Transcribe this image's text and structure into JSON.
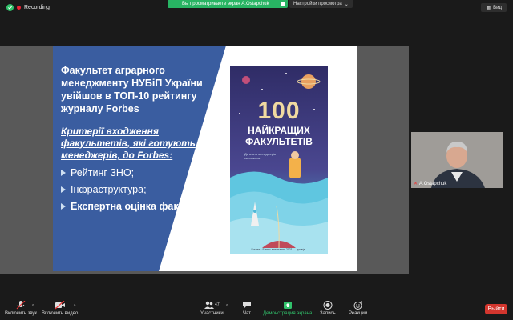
{
  "top": {
    "recording_label": "Recording",
    "banner_text": "Вы просматриваете экран A.Ostapchuk",
    "view_options": "Настройки просмотра",
    "view_button": "Вид"
  },
  "slide": {
    "title": "Факультет аграрного менеджменту НУБіП України увійшов в ТОП-10 рейтингу журналу Forbes",
    "subtitle": "Критерії входження факультетів, які готують менеджерів, до Forbes:",
    "bullets": [
      {
        "text": "Рейтинг ЗНО;",
        "bold": false
      },
      {
        "text": "Інфраструктура;",
        "bold": false
      },
      {
        "text": "Експертна оцінка факультету",
        "bold": true
      }
    ],
    "book": {
      "number": "100",
      "title_line1": "НАЙКРАЩИХ",
      "title_line2": "ФАКУЛЬТЕТІВ",
      "small_text": "Де вчать менеджерів і сировинок",
      "footer": "Forbes · Бізнес-виконання 2021 — досвід",
      "colors": {
        "sky": "#3d3a79",
        "sea": "#4fb8d8",
        "accent": "#f0d9a0"
      }
    },
    "colors": {
      "panel": "#3a5da0",
      "background": "#ffffff"
    }
  },
  "participant": {
    "name": "A.Ostapchuk"
  },
  "toolbar": {
    "mute": "Включить звук",
    "video": "Включить видео",
    "participants": "Участники",
    "participants_count": "47",
    "chat": "Чат",
    "share": "Демонстрация экрана",
    "record": "Запись",
    "reactions": "Реакции",
    "end": "Выйти",
    "share_color": "#31c26b",
    "end_color": "#d3362e"
  }
}
